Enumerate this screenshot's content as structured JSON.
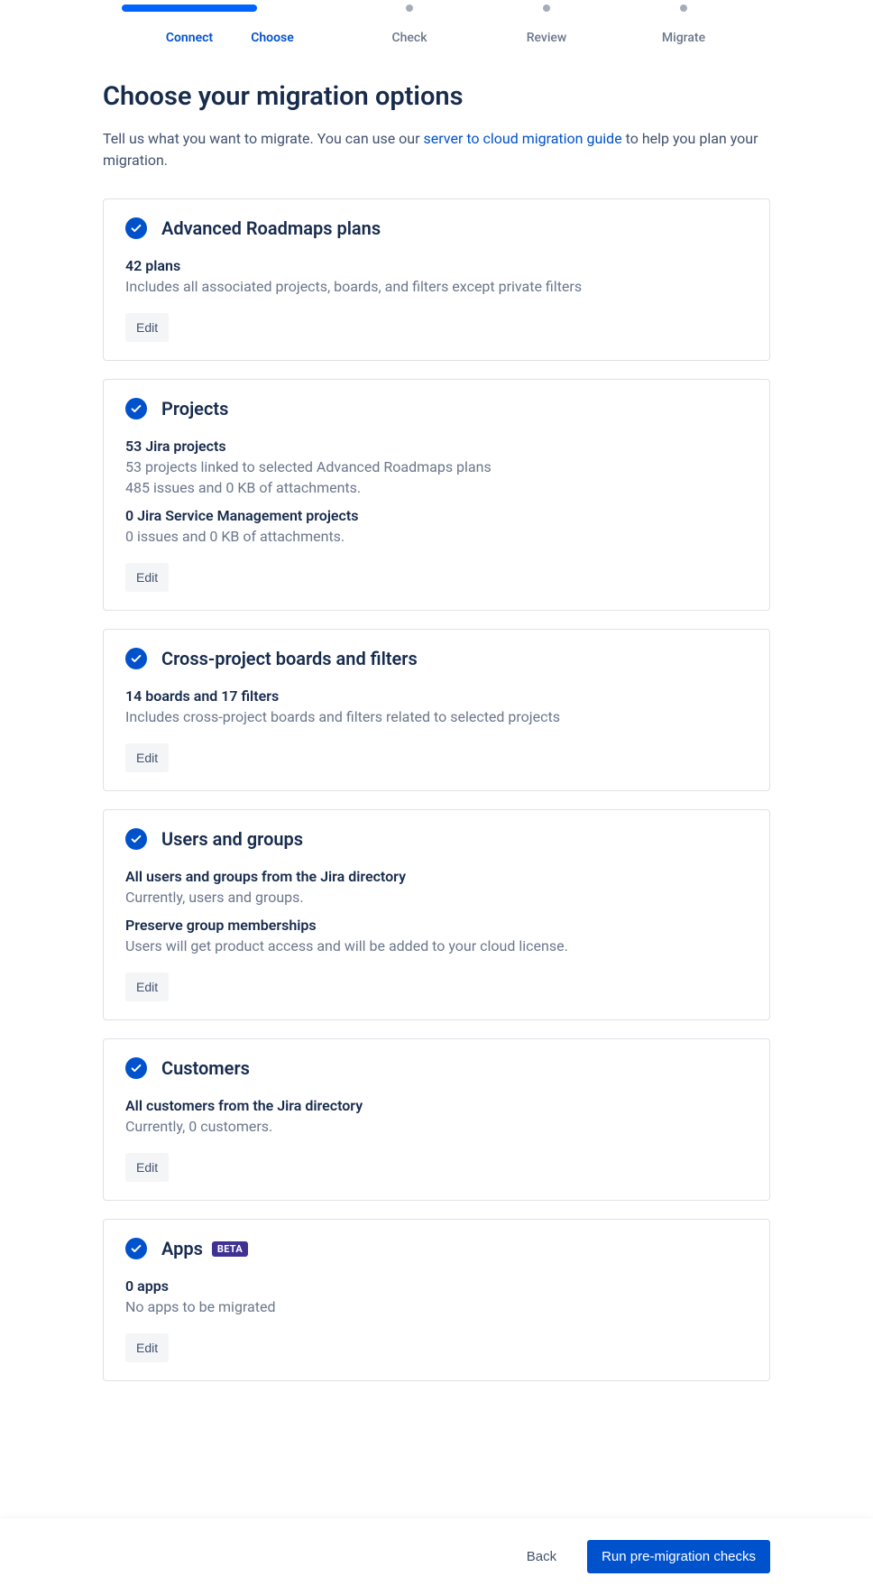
{
  "stepper": {
    "steps": [
      {
        "label": "Connect",
        "state": "active"
      },
      {
        "label": "Choose",
        "state": "active"
      },
      {
        "label": "Check",
        "state": "upcoming"
      },
      {
        "label": "Review",
        "state": "upcoming"
      },
      {
        "label": "Migrate",
        "state": "upcoming"
      }
    ]
  },
  "page": {
    "title": "Choose your migration options",
    "description_prefix": "Tell us what you want to migrate. You can use our ",
    "description_link": "server to cloud migration guide",
    "description_suffix": " to help you plan your migration."
  },
  "cards": {
    "roadmaps": {
      "title": "Advanced Roadmaps plans",
      "summary": "42 plans",
      "detail": "Includes all associated projects, boards, and filters except private filters",
      "edit": "Edit"
    },
    "projects": {
      "title": "Projects",
      "summary1": "53 Jira projects",
      "detail1": "53 projects linked to selected Advanced Roadmaps plans",
      "detail1b": "485 issues and 0 KB of attachments.",
      "summary2": "0 Jira Service Management projects",
      "detail2": "0 issues and 0 KB of attachments.",
      "edit": "Edit"
    },
    "boards": {
      "title": "Cross-project boards and filters",
      "summary": "14 boards and 17 filters",
      "detail": "Includes cross-project boards and filters related to selected projects",
      "edit": "Edit"
    },
    "users": {
      "title": "Users and groups",
      "summary1": "All users and groups from the Jira directory",
      "detail1": "Currently, users and groups.",
      "summary2": "Preserve group memberships",
      "detail2": "Users will get product access and will be added to your cloud license.",
      "edit": "Edit"
    },
    "customers": {
      "title": "Customers",
      "summary": "All customers from the Jira directory",
      "detail": "Currently, 0 customers.",
      "edit": "Edit"
    },
    "apps": {
      "title": "Apps",
      "badge": "BETA",
      "summary": "0 apps",
      "detail": "No apps to be migrated",
      "edit": "Edit"
    }
  },
  "footer": {
    "back": "Back",
    "primary": "Run pre-migration checks"
  }
}
